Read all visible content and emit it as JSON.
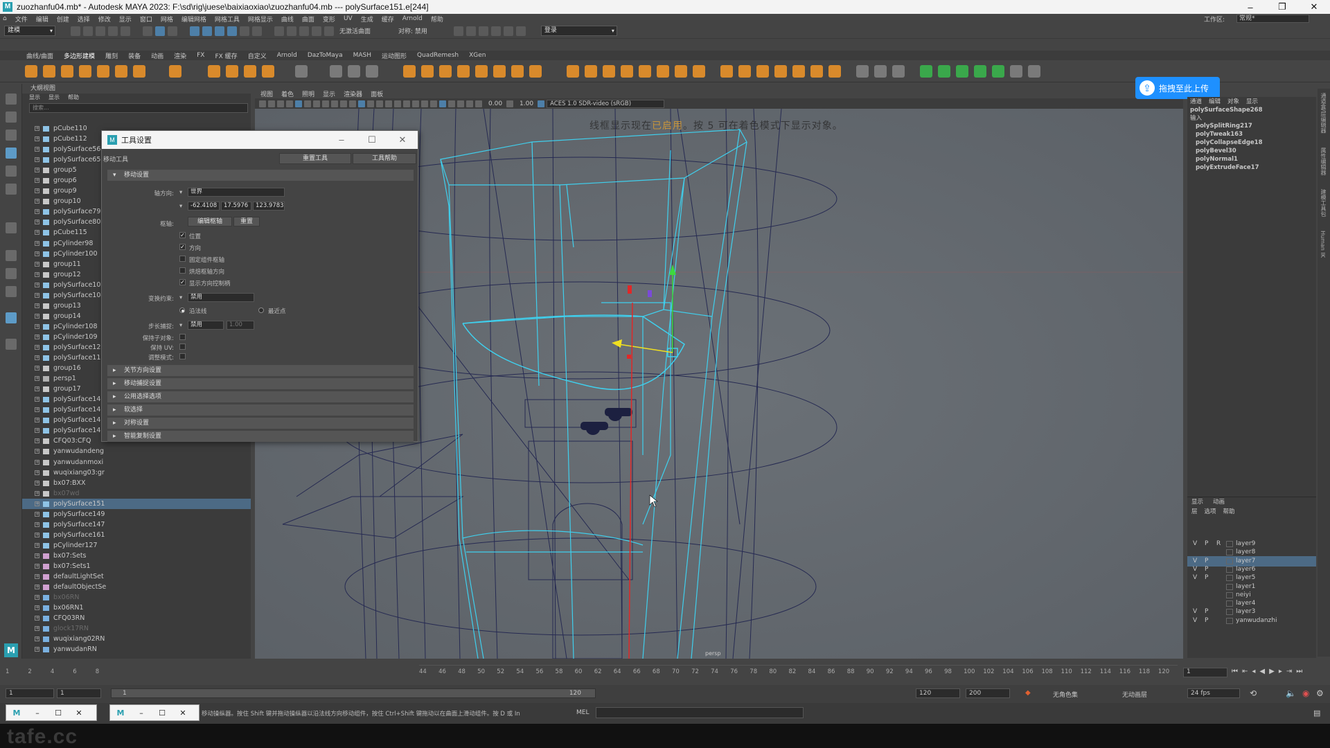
{
  "window": {
    "title": "zuozhanfu04.mb* - Autodesk MAYA 2023: F:\\sd\\rig\\juese\\baixiaoxiao\\zuozhanfu04.mb  ---  polySurface151.e[244]",
    "minimize": "–",
    "maximize": "❐",
    "close": "✕"
  },
  "menubar": {
    "items": [
      "文件",
      "编辑",
      "创建",
      "选择",
      "修改",
      "显示",
      "窗口",
      "网格",
      "编辑网格",
      "网格工具",
      "网格显示",
      "曲线",
      "曲面",
      "变形",
      "UV",
      "生成",
      "缓存",
      "Arnold",
      "帮助"
    ],
    "workspace_label": "工作区:",
    "workspace_value": "常规*"
  },
  "statusline": {
    "mode": "建模",
    "live_surface": "无激活曲面",
    "symmetry": "对称: 禁用",
    "login": "登录"
  },
  "shelf": {
    "tabs": [
      "曲线/曲面",
      "多边形建模",
      "雕刻",
      "装备",
      "动画",
      "渲染",
      "FX",
      "FX 缓存",
      "自定义",
      "Arnold",
      "DazToMaya",
      "MASH",
      "运动图形",
      "QuadRemesh",
      "XGen"
    ]
  },
  "outliner": {
    "title": "大纲视图",
    "menu": [
      "显示",
      "显示",
      "帮助"
    ],
    "search_placeholder": "搜索...",
    "items": [
      {
        "name": "pCube110",
        "icon": "mesh"
      },
      {
        "name": "pCube112",
        "icon": "mesh"
      },
      {
        "name": "polySurface56",
        "icon": "mesh"
      },
      {
        "name": "polySurface65",
        "icon": "mesh"
      },
      {
        "name": "group5",
        "icon": "group"
      },
      {
        "name": "group6",
        "icon": "group"
      },
      {
        "name": "group9",
        "icon": "group"
      },
      {
        "name": "group10",
        "icon": "group"
      },
      {
        "name": "polySurface79",
        "icon": "mesh"
      },
      {
        "name": "polySurface80",
        "icon": "mesh"
      },
      {
        "name": "pCube115",
        "icon": "mesh"
      },
      {
        "name": "pCylinder98",
        "icon": "mesh"
      },
      {
        "name": "pCylinder100",
        "icon": "mesh"
      },
      {
        "name": "group11",
        "icon": "group"
      },
      {
        "name": "group12",
        "icon": "group"
      },
      {
        "name": "polySurface103",
        "icon": "mesh"
      },
      {
        "name": "polySurface104",
        "icon": "mesh"
      },
      {
        "name": "group13",
        "icon": "group"
      },
      {
        "name": "group14",
        "icon": "group"
      },
      {
        "name": "pCylinder108",
        "icon": "mesh"
      },
      {
        "name": "pCylinder109",
        "icon": "mesh"
      },
      {
        "name": "polySurface125",
        "icon": "mesh"
      },
      {
        "name": "polySurface119",
        "icon": "mesh"
      },
      {
        "name": "group16",
        "icon": "group"
      },
      {
        "name": "persp1",
        "icon": "camera"
      },
      {
        "name": "group17",
        "icon": "group"
      },
      {
        "name": "polySurface140",
        "icon": "mesh"
      },
      {
        "name": "polySurface141",
        "icon": "mesh"
      },
      {
        "name": "polySurface142",
        "icon": "mesh"
      },
      {
        "name": "polySurface143",
        "icon": "mesh"
      },
      {
        "name": "CFQ03:CFQ",
        "icon": "group"
      },
      {
        "name": "yanwudandeng",
        "icon": "group"
      },
      {
        "name": "yanwudanmoxi",
        "icon": "group"
      },
      {
        "name": "wuqixiang03:gr",
        "icon": "group"
      },
      {
        "name": "bx07:BXX",
        "icon": "group"
      },
      {
        "name": "bx07wd",
        "icon": "group",
        "dim": true
      },
      {
        "name": "polySurface151",
        "icon": "mesh",
        "selected": true
      },
      {
        "name": "polySurface149",
        "icon": "mesh"
      },
      {
        "name": "polySurface147",
        "icon": "mesh"
      },
      {
        "name": "polySurface161",
        "icon": "mesh"
      },
      {
        "name": "pCylinder127",
        "icon": "mesh"
      },
      {
        "name": "bx07:Sets",
        "icon": "set"
      },
      {
        "name": "bx07:Sets1",
        "icon": "set"
      },
      {
        "name": "defaultLightSet",
        "icon": "set"
      },
      {
        "name": "defaultObjectSe",
        "icon": "set"
      },
      {
        "name": "bx06RN",
        "icon": "ref",
        "dim": true
      },
      {
        "name": "bx06RN1",
        "icon": "ref"
      },
      {
        "name": "CFQ03RN",
        "icon": "ref"
      },
      {
        "name": "glock17RN",
        "icon": "ref",
        "dim": true
      },
      {
        "name": "wuqixiang02RN",
        "icon": "ref"
      },
      {
        "name": "yanwudanRN",
        "icon": "ref"
      }
    ]
  },
  "tool_settings": {
    "title": "工具设置",
    "tool_name": "移动工具",
    "reset_button": "重置工具",
    "help_button": "工具帮助",
    "section_move": "移动设置",
    "axis_orient_label": "轴方向:",
    "axis_orient_value": "世界",
    "coords": [
      "-62.4108",
      "17.5976",
      "123.9783"
    ],
    "pivot_label": "枢轴:",
    "edit_pivot_button": "编辑枢轴",
    "reset_pivot_button": "重置",
    "checkboxes": [
      {
        "label": "位置",
        "checked": true
      },
      {
        "label": "方向",
        "checked": true
      },
      {
        "label": "固定组件枢轴",
        "checked": false
      },
      {
        "label": "烘焙枢轴方向",
        "checked": false
      },
      {
        "label": "显示方向控制柄",
        "checked": true
      }
    ],
    "snap_constraint_label": "变换约束:",
    "snap_constraint_value": "禁用",
    "radio_edge": "沿法线",
    "radio_near": "最近点",
    "step_snap_label": "步长捕捉:",
    "step_snap_value": "禁用",
    "step_snap_num": "1.00",
    "preserve_children_label": "保持子对象:",
    "preserve_uv_label": "保持 UV:",
    "tweak_mode_label": "调整模式:",
    "collapsed_sections": [
      "关节方向设置",
      "移动捕捉设置",
      "公用选择选项",
      "软选择",
      "对称设置",
      "智能复制设置"
    ]
  },
  "viewport": {
    "menu": [
      "视图",
      "着色",
      "照明",
      "显示",
      "渲染器",
      "面板"
    ],
    "num1": "0.00",
    "num2": "1.00",
    "colorspace": "ACES 1.0 SDR-video (sRGB)",
    "hud_before": "线框显示现在",
    "hud_highlight": "已启用",
    "hud_after": "。按 5 可在着色模式下显示对象。",
    "camera": "persp"
  },
  "upload_button": "拖拽至此上传",
  "channel_box": {
    "tabs": [
      "通道",
      "编辑",
      "对象",
      "显示"
    ],
    "shape_name": "polySurfaceShape268",
    "inputs_label": "输入",
    "inputs": [
      "polySplitRing217",
      "polyTweak163",
      "polyCollapseEdge18",
      "polyBevel30",
      "polyNormal1",
      "polyExtrudeFace17"
    ]
  },
  "right_strip": [
    "通道盒/层编辑器",
    "属性编辑器",
    "建模工具包",
    "Human IK"
  ],
  "layer_editor": {
    "tabs": [
      "显示",
      "动画"
    ],
    "menu": [
      "层",
      "选项",
      "帮助"
    ],
    "layers": [
      {
        "v": "V",
        "p": "P",
        "r": "R",
        "name": "layer9"
      },
      {
        "v": "",
        "p": "",
        "r": "",
        "name": "layer8"
      },
      {
        "v": "V",
        "p": "P",
        "r": "",
        "name": "layer7",
        "selected": true
      },
      {
        "v": "V",
        "p": "P",
        "r": "",
        "name": "layer6"
      },
      {
        "v": "V",
        "p": "P",
        "r": "",
        "name": "layer5"
      },
      {
        "v": "",
        "p": "",
        "r": "",
        "name": "layer1"
      },
      {
        "v": "",
        "p": "",
        "r": "",
        "name": "neiyi"
      },
      {
        "v": "",
        "p": "",
        "r": "",
        "name": "layer4"
      },
      {
        "v": "V",
        "p": "P",
        "r": "",
        "name": "layer3"
      },
      {
        "v": "V",
        "p": "P",
        "r": "",
        "name": "yanwudanzhi"
      }
    ]
  },
  "timeslider": {
    "left_nums": [
      "1",
      "2",
      "4",
      "6",
      "8"
    ],
    "ticks": [
      "44",
      "46",
      "48",
      "50",
      "52",
      "54",
      "56",
      "58",
      "60",
      "62",
      "64",
      "66",
      "68",
      "70",
      "72",
      "74",
      "76",
      "78",
      "80",
      "82",
      "84",
      "86",
      "88",
      "90",
      "92",
      "94",
      "96",
      "98",
      "100",
      "102",
      "104",
      "106",
      "108",
      "110",
      "112",
      "114",
      "116",
      "118",
      "120"
    ],
    "current_frame": "1"
  },
  "rangeslider": {
    "start": "1",
    "start2": "1",
    "bar_start": "1",
    "bar_end": "120",
    "end": "120",
    "end2": "200",
    "char_set": "无角色集",
    "anim_layer": "无动画层",
    "fps": "24 fps"
  },
  "helpline": {
    "hint": "移动操纵器。按住 Shift 键并拖动操纵器以沿法线方向移动组件，按住 Ctrl+Shift 键拖动以在曲面上滑动组件。按 D 或 In",
    "mel": "MEL"
  },
  "footer": {
    "watermark": "tafe.cc"
  }
}
